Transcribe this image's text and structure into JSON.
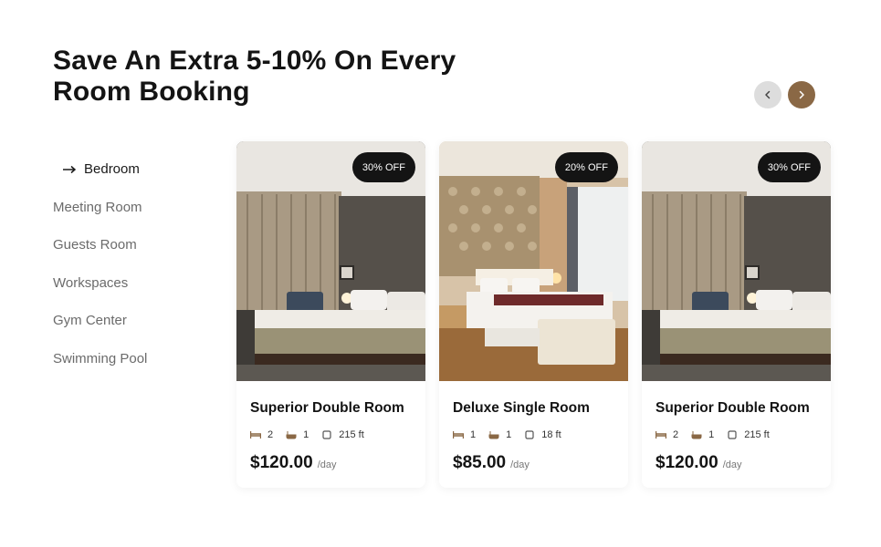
{
  "heading": {
    "line1": "Save An Extra 5-10% On Every",
    "line2": "Room Booking"
  },
  "carousel": {
    "prev_icon": "chevron-left-icon",
    "next_icon": "chevron-right-icon",
    "accent": "#8a6845"
  },
  "categories": [
    {
      "label": "Bedroom",
      "active": true
    },
    {
      "label": "Meeting Room"
    },
    {
      "label": "Guests Room"
    },
    {
      "label": "Workspaces"
    },
    {
      "label": "Gym Center"
    },
    {
      "label": "Swimming Pool"
    }
  ],
  "rooms": [
    {
      "badge": "30% OFF",
      "title": "Superior Double Room",
      "beds": "2",
      "baths": "1",
      "area": "215 ft",
      "price": "$120.00",
      "per": "/day"
    },
    {
      "badge": "20% OFF",
      "title": "Deluxe Single Room",
      "beds": "1",
      "baths": "1",
      "area": "18 ft",
      "price": "$85.00",
      "per": "/day"
    },
    {
      "badge": "30% OFF",
      "title": "Superior Double Room",
      "beds": "2",
      "baths": "1",
      "area": "215 ft",
      "price": "$120.00",
      "per": "/day"
    }
  ]
}
